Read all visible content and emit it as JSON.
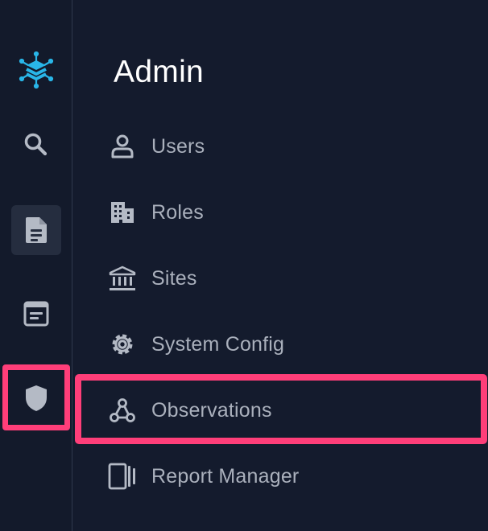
{
  "colors": {
    "background": "#141b2d",
    "rail_background": "#131a2b",
    "active_rail_item": "#252d3f",
    "text_primary": "#ffffff",
    "text_secondary": "#aab0bc",
    "icon": "#b4bac5",
    "brand": "#29b6e8",
    "highlight": "#ff3e79"
  },
  "rail": {
    "items": [
      {
        "icon": "network-cube-logo-icon",
        "active": false
      },
      {
        "icon": "search-icon",
        "active": false
      },
      {
        "icon": "document-icon",
        "active": true
      },
      {
        "icon": "notes-panel-icon",
        "active": false
      },
      {
        "icon": "shield-icon",
        "active": false,
        "highlighted": true
      }
    ]
  },
  "main": {
    "title": "Admin",
    "items": [
      {
        "label": "Users",
        "icon": "user-icon"
      },
      {
        "label": "Roles",
        "icon": "building-icon"
      },
      {
        "label": "Sites",
        "icon": "institution-icon"
      },
      {
        "label": "System Config",
        "icon": "gear-icon"
      },
      {
        "label": "Observations",
        "icon": "webhook-icon",
        "highlighted": true
      },
      {
        "label": "Report Manager",
        "icon": "report-manager-icon"
      }
    ]
  }
}
